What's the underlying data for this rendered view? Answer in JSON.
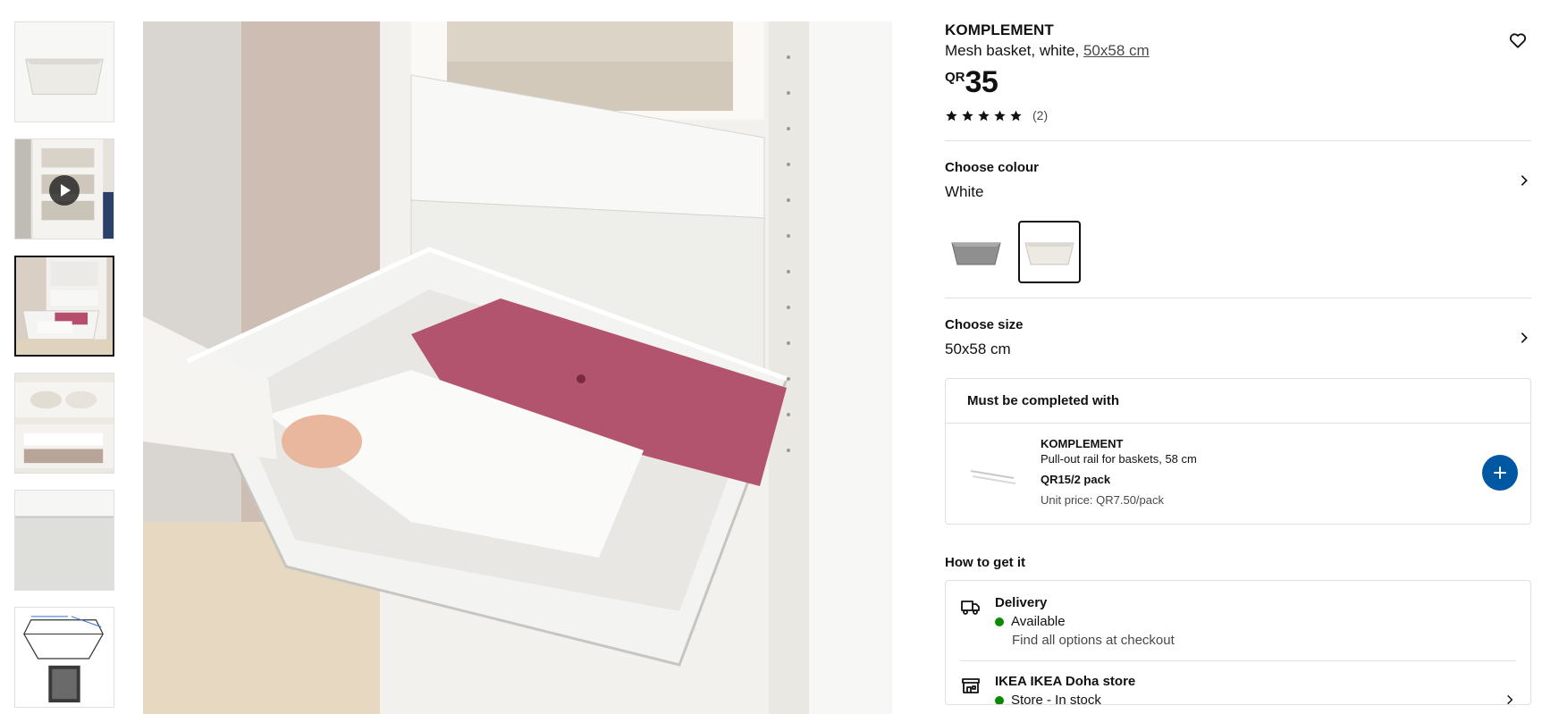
{
  "product": {
    "name": "KOMPLEMENT",
    "description": "Mesh basket, white, ",
    "size_link": "50x58 cm",
    "currency": "QR",
    "price": "35",
    "rating_stars": 5,
    "rating_count": "(2)"
  },
  "colour": {
    "title": "Choose colour",
    "value": "White",
    "options": [
      {
        "name": "dark-grey",
        "color": "#8a8a8a",
        "selected": false
      },
      {
        "name": "white",
        "color": "#e9e7e1",
        "selected": true
      }
    ]
  },
  "size": {
    "title": "Choose size",
    "value": "50x58 cm"
  },
  "must_complete": {
    "title": "Must be completed with",
    "item_name": "KOMPLEMENT",
    "item_desc": "Pull-out rail for baskets, 58 cm",
    "item_price": "QR15/2 pack",
    "unit_price": "Unit price: QR7.50/pack"
  },
  "how_to_get": {
    "title": "How to get it",
    "delivery_title": "Delivery",
    "delivery_status": "Available",
    "delivery_sub": "Find all options at checkout",
    "store_title": "IKEA IKEA Doha store",
    "store_status": "Store - In stock"
  },
  "thumbnails": [
    {
      "name": "basket-product",
      "active": false
    },
    {
      "name": "video",
      "active": false
    },
    {
      "name": "lifestyle-drawer",
      "active": true
    },
    {
      "name": "baskets-in-wardrobe",
      "active": false
    },
    {
      "name": "mesh-closeup",
      "active": false
    },
    {
      "name": "dimension-drawing",
      "active": false
    }
  ],
  "colors": {
    "accent_blue": "#0058a3",
    "available_green": "#0a8a00"
  }
}
